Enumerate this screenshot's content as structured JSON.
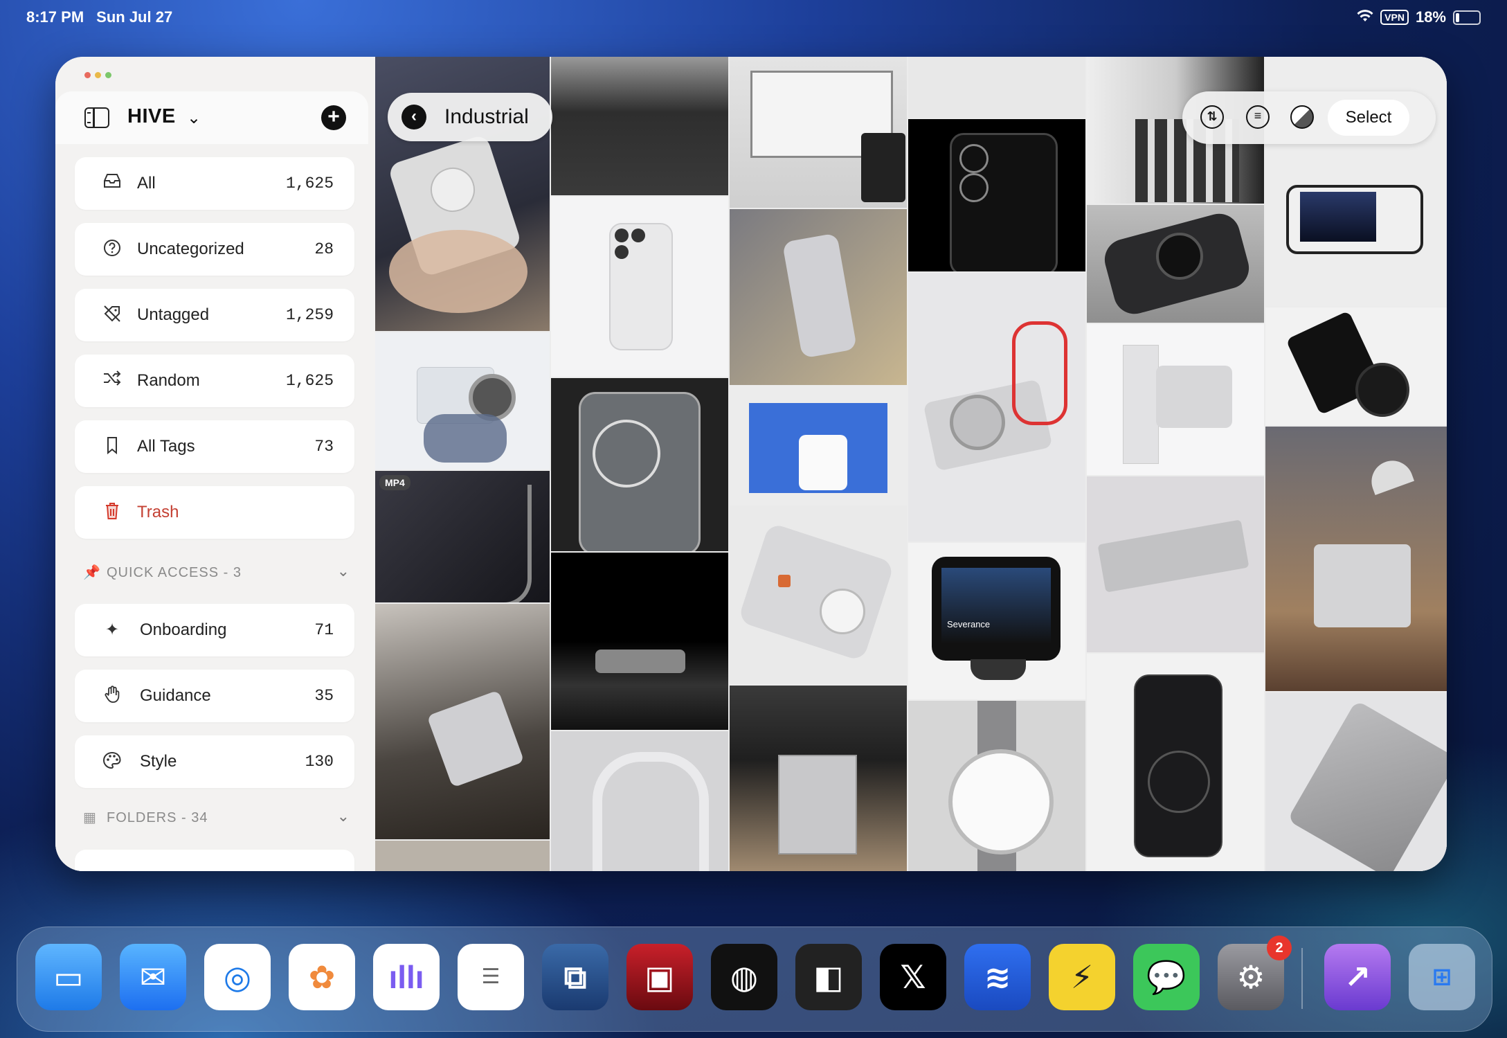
{
  "status_bar": {
    "time": "8:17 PM",
    "date": "Sun Jul 27",
    "vpn": "VPN",
    "battery": "18%",
    "battery_level": 0.18
  },
  "sidebar": {
    "title": "HIVE",
    "items": [
      {
        "label": "All",
        "count": "1,625",
        "icon": "inbox-tray-icon"
      },
      {
        "label": "Uncategorized",
        "count": "28",
        "icon": "question-circle-icon"
      },
      {
        "label": "Untagged",
        "count": "1,259",
        "icon": "tag-slash-icon"
      },
      {
        "label": "Random",
        "count": "1,625",
        "icon": "shuffle-icon"
      },
      {
        "label": "All Tags",
        "count": "73",
        "icon": "bookmark-icon"
      },
      {
        "label": "Trash",
        "count": "",
        "icon": "trash-icon"
      }
    ],
    "quick_access": {
      "label": "QUICK ACCESS - 3",
      "items": [
        {
          "label": "Onboarding",
          "count": "71",
          "icon": "sparkles-icon"
        },
        {
          "label": "Guidance",
          "count": "35",
          "icon": "hand-icon"
        },
        {
          "label": "Style",
          "count": "130",
          "icon": "palette-icon"
        }
      ]
    },
    "folders": {
      "label": "FOLDERS - 34"
    }
  },
  "collection": {
    "title": "Industrial"
  },
  "toolbar": {
    "select_label": "Select"
  },
  "gallery": {
    "video_badge": "MP4",
    "caption": "Severance"
  },
  "dock": {
    "apps": [
      "Files",
      "Mail",
      "Safari",
      "Photos",
      "Podcasts",
      "Reminders",
      "Frame",
      "Screens",
      "Lines",
      "Overlap",
      "X",
      "Wave",
      "Shortcuts",
      "WeChat",
      "Settings",
      "Swifter",
      "App Library"
    ],
    "settings_badge": "2"
  },
  "colors": {
    "accent_dark": "#111111",
    "trash_red": "#c44033",
    "window_bg": "#f3f2f1"
  }
}
